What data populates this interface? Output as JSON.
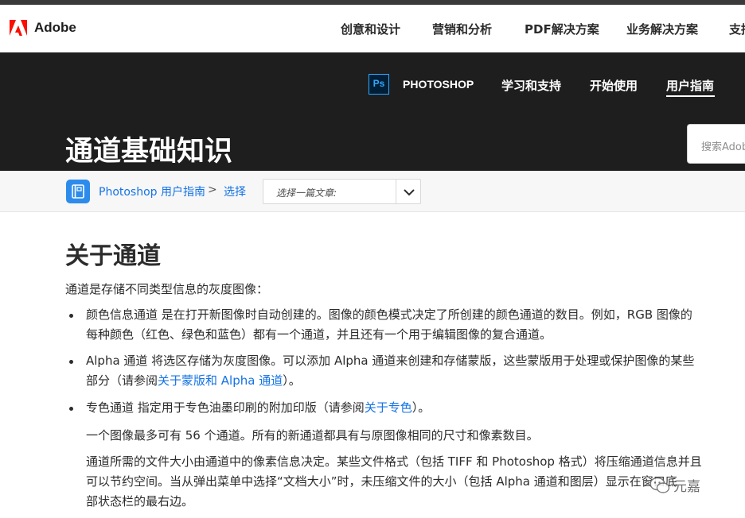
{
  "global_nav": {
    "brand": "Adobe",
    "items": [
      "创意和设计",
      "营销和分析",
      "PDF解决方案",
      "业务解决方案",
      "支持"
    ]
  },
  "product_nav": {
    "product_badge": "Ps",
    "product_name": "PHOTOSHOP",
    "items": [
      "学习和支持",
      "开始使用",
      "用户指南"
    ],
    "active_index": 2,
    "page_title": "通道基础知识",
    "search_placeholder": "搜索Adobe支持"
  },
  "breadcrumb": {
    "guide": "Photoshop 用户指南",
    "separator": ">",
    "section": "选择",
    "article_select": "选择一篇文章:"
  },
  "article": {
    "heading": "关于通道",
    "intro": "通道是存储不同类型信息的灰度图像：",
    "bullet1": {
      "line1": "颜色信息通道 是在打开新图像时自动创建的。图像的颜色模式决定了所创建的颜色通道的数目。例如，RGB 图像的",
      "line2": "每种颜色（红色、绿色和蓝色）都有一个通道，并且还有一个用于编辑图像的复合通道。"
    },
    "bullet2": {
      "line1": "Alpha 通道 将选区存储为灰度图像。可以添加 Alpha 通道来创建和存储蒙版，这些蒙版用于处理或保护图像的某些",
      "line2_pre": "部分（请参阅",
      "line2_link": "关于蒙版和 Alpha 通道",
      "line2_post": "）。"
    },
    "bullet3": {
      "pre": "专色通道 指定用于专色油墨印刷的附加印版（请参阅",
      "link": "关于专色",
      "post": "）。"
    },
    "para1": "一个图像最多可有 56 个通道。所有的新通道都具有与原图像相同的尺寸和像素数目。",
    "para2": {
      "line1": "通道所需的文件大小由通道中的像素信息决定。某些文件格式（包括 TIFF 和 Photoshop 格式）将压缩通道信息并且",
      "line2": "可以节约空间。当从弹出菜单中选择“文档大小”时，未压缩文件的大小（包括 Alpha 通道和图层）显示在窗口底",
      "line3": "部状态栏的最右边。"
    }
  },
  "watermark": {
    "text": "元嘉"
  },
  "colors": {
    "link": "#1473e6",
    "product_bar": "#1e1e1e",
    "adobe_red": "#fa0f00",
    "ps_blue": "#31a8ff"
  }
}
